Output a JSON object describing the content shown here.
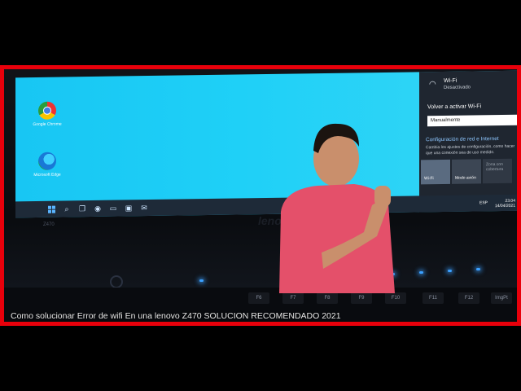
{
  "caption": "Como solucionar Error de wifi En  una lenovo Z470 SOLUCION RECOMENDADO 2021",
  "laptop": {
    "brand": "lenovo",
    "model": "Z470"
  },
  "desktop": {
    "icons": [
      {
        "label": "Google Chrome",
        "icon": "chrome-icon"
      },
      {
        "label": "Microsoft Edge",
        "icon": "edge-icon"
      }
    ]
  },
  "network_panel": {
    "wifi_title": "Wi-Fi",
    "wifi_status": "Desactivado",
    "reactivate_label": "Volver a activar Wi-Fi",
    "dropdown_value": "Manualmente",
    "settings_link": "Configuración de red e Internet",
    "settings_desc": "Cambia los ajustes de configuración, como hacer que una conexión sea de uso medido.",
    "quick_actions": [
      "Wi-Fi",
      "Modo avión",
      "Zona con cobertura"
    ]
  },
  "taskbar": {
    "time": "23:04",
    "date": "14/04/2021",
    "lang": "ESP"
  },
  "function_keys": [
    "F6",
    "F7",
    "F8",
    "F9",
    "F10",
    "F11",
    "F12",
    "ImgPt"
  ],
  "colors": {
    "border": "#e8000b",
    "desktop": "#1fd0f7",
    "shirt": "#e4506a"
  }
}
